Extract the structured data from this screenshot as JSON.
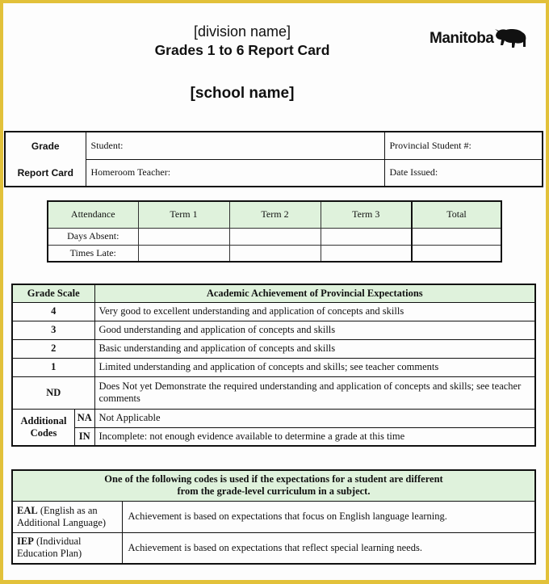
{
  "header": {
    "division": "[division name]",
    "title": "Grades 1 to 6 Report Card",
    "school": "[school name]",
    "logo_text": "Manitoba",
    "logo_icon": "bison-icon"
  },
  "info": {
    "label_line1": "Grade",
    "label_line2": "Report Card",
    "student": "Student:",
    "provincial_student": "Provincial Student #:",
    "homeroom_teacher": "Homeroom Teacher:",
    "date_issued": "Date Issued:"
  },
  "attendance": {
    "headers": [
      "Attendance",
      "Term 1",
      "Term 2",
      "Term 3",
      "Total"
    ],
    "rows": [
      {
        "label": "Days Absent:",
        "values": [
          "",
          "",
          "",
          ""
        ]
      },
      {
        "label": "Times Late:",
        "values": [
          "",
          "",
          "",
          ""
        ]
      }
    ]
  },
  "scale": {
    "header_grade": "Grade Scale",
    "header_desc": "Academic Achievement of Provincial Expectations",
    "rows": [
      {
        "grade": "4",
        "desc": "Very good to excellent understanding and application of concepts and skills"
      },
      {
        "grade": "3",
        "desc": "Good understanding and application of concepts and skills"
      },
      {
        "grade": "2",
        "desc": "Basic understanding and application of concepts and skills"
      },
      {
        "grade": "1",
        "desc": "Limited understanding and application of concepts and skills; see teacher comments"
      },
      {
        "grade": "ND",
        "desc": "Does Not yet Demonstrate the required understanding and application of concepts and skills; see teacher comments"
      }
    ],
    "additional_label_1": "Additional",
    "additional_label_2": "Codes",
    "additional": [
      {
        "code": "NA",
        "desc": "Not Applicable"
      },
      {
        "code": "IN",
        "desc": "Incomplete: not enough evidence available to determine a grade at this time"
      }
    ]
  },
  "codes": {
    "header_line1": "One of the following codes is used if the expectations for a student are different",
    "header_line2": "from the grade-level curriculum in a subject.",
    "rows": [
      {
        "code": "EAL",
        "name": "(English as an Additional Language)",
        "desc": "Achievement is based on expectations that focus on English language learning."
      },
      {
        "code": "IEP",
        "name": "(Individual Education Plan)",
        "desc": "Achievement is based on expectations that reflect special learning needs."
      }
    ]
  },
  "colors": {
    "frame": "#e2c13a",
    "header_fill": "#dff2dc"
  }
}
